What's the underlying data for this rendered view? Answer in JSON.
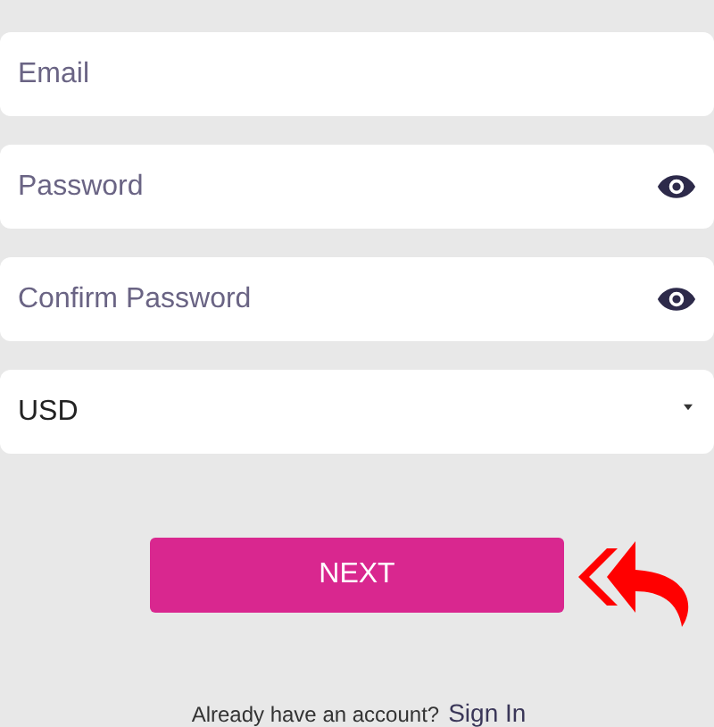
{
  "fields": [
    {
      "kind": "text",
      "placeholder": "Email"
    },
    {
      "kind": "password",
      "placeholder": "Password"
    },
    {
      "kind": "password",
      "placeholder": "Confirm Password"
    },
    {
      "kind": "select",
      "value": "USD"
    }
  ],
  "next_button": {
    "label": "NEXT"
  },
  "footer": {
    "text": "Already have an account?",
    "link": "Sign In"
  }
}
